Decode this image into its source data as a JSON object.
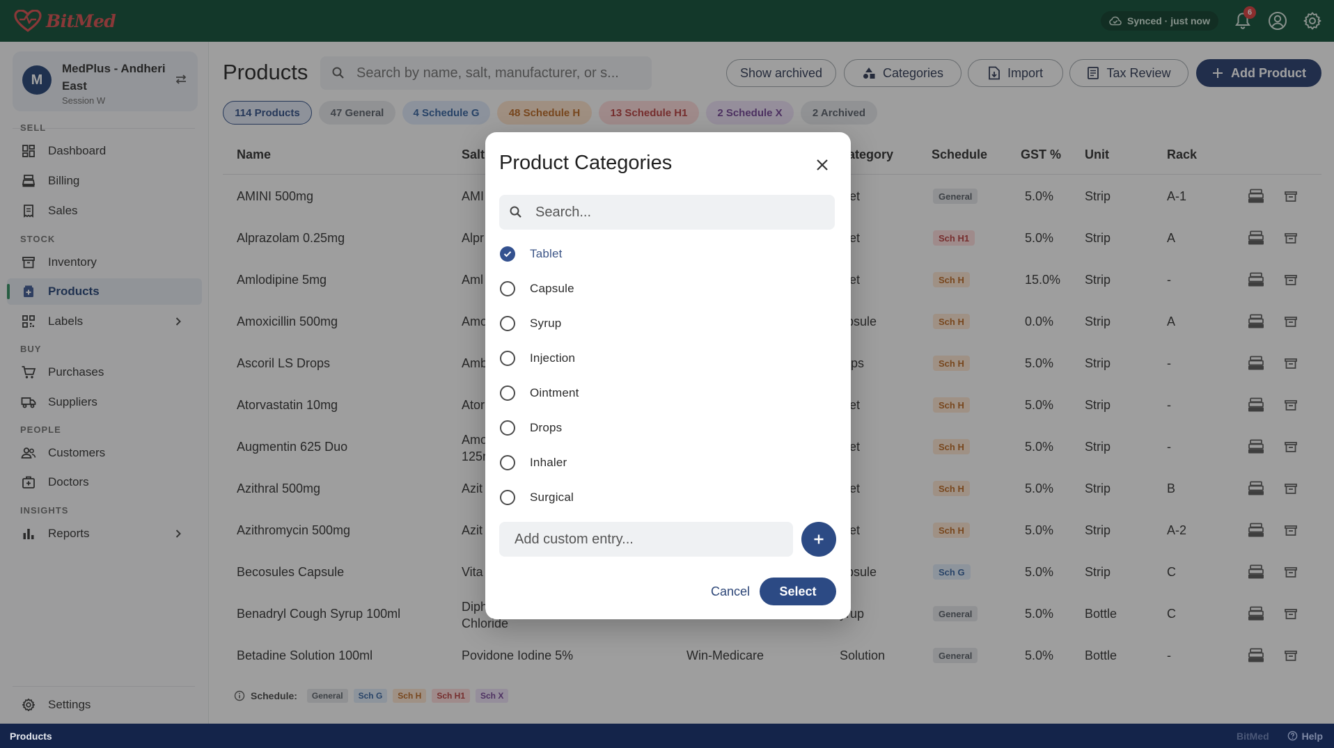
{
  "app": {
    "brand": "BitMed",
    "sync_status": "Synced · just now",
    "notification_count": "6"
  },
  "store": {
    "avatar_letter": "M",
    "name": "MedPlus - Andheri East",
    "session": "Session W"
  },
  "nav": {
    "sections": {
      "sell": "SELL",
      "stock": "STOCK",
      "buy": "BUY",
      "people": "PEOPLE",
      "insights": "INSIGHTS"
    },
    "items": {
      "dashboard": "Dashboard",
      "billing": "Billing",
      "sales": "Sales",
      "inventory": "Inventory",
      "products": "Products",
      "labels": "Labels",
      "purchases": "Purchases",
      "suppliers": "Suppliers",
      "customers": "Customers",
      "doctors": "Doctors",
      "reports": "Reports",
      "settings": "Settings"
    }
  },
  "page": {
    "title": "Products",
    "search_placeholder": "Search by name, salt, manufacturer, or s...",
    "buttons": {
      "show_archived": "Show archived",
      "categories": "Categories",
      "import": "Import",
      "tax_review": "Tax Review",
      "add_product": "Add Product"
    },
    "chips": {
      "all": "114 Products",
      "general": "47 General",
      "schedule_g": "4 Schedule G",
      "schedule_h": "48 Schedule H",
      "schedule_h1": "13 Schedule H1",
      "schedule_x": "2 Schedule X",
      "archived": "2 Archived"
    }
  },
  "table": {
    "headers": {
      "name": "Name",
      "salt": "Salt",
      "category": "ategory",
      "schedule": "Schedule",
      "gst": "GST %",
      "unit": "Unit",
      "rack": "Rack"
    },
    "rows": [
      {
        "name": "AMINI 500mg",
        "salt": "AMI",
        "salt2": "",
        "manufacturer": "",
        "category": "blet",
        "schedule": "General",
        "gst": "5.0%",
        "unit": "Strip",
        "rack": "A-1"
      },
      {
        "name": "Alprazolam 0.25mg",
        "salt": "Alpr",
        "salt2": "",
        "manufacturer": "",
        "category": "blet",
        "schedule": "Sch H1",
        "gst": "5.0%",
        "unit": "Strip",
        "rack": "A"
      },
      {
        "name": "Amlodipine 5mg",
        "salt": "Aml",
        "salt2": "",
        "manufacturer": "",
        "category": "blet",
        "schedule": "Sch H",
        "gst": "15.0%",
        "unit": "Strip",
        "rack": "-"
      },
      {
        "name": "Amoxicillin 500mg",
        "salt": "Amo",
        "salt2": "",
        "manufacturer": "",
        "category": "apsule",
        "schedule": "Sch H",
        "gst": "0.0%",
        "unit": "Strip",
        "rack": "A"
      },
      {
        "name": "Ascoril LS Drops",
        "salt": "Amb",
        "salt2": "",
        "manufacturer": "",
        "category": "rops",
        "schedule": "Sch H",
        "gst": "5.0%",
        "unit": "Strip",
        "rack": "-"
      },
      {
        "name": "Atorvastatin 10mg",
        "salt": "Ator",
        "salt2": "",
        "manufacturer": "",
        "category": "blet",
        "schedule": "Sch H",
        "gst": "5.0%",
        "unit": "Strip",
        "rack": "-"
      },
      {
        "name": "Augmentin 625 Duo",
        "salt": "Amo",
        "salt2": "125r",
        "manufacturer": "",
        "category": "blet",
        "schedule": "Sch H",
        "gst": "5.0%",
        "unit": "Strip",
        "rack": "-"
      },
      {
        "name": "Azithral 500mg",
        "salt": "Azit",
        "salt2": "",
        "manufacturer": "",
        "category": "blet",
        "schedule": "Sch H",
        "gst": "5.0%",
        "unit": "Strip",
        "rack": "B"
      },
      {
        "name": "Azithromycin 500mg",
        "salt": "Azit",
        "salt2": "",
        "manufacturer": "",
        "category": "blet",
        "schedule": "Sch H",
        "gst": "5.0%",
        "unit": "Strip",
        "rack": "A-2"
      },
      {
        "name": "Becosules Capsule",
        "salt": "Vita",
        "salt2": "",
        "manufacturer": "",
        "category": "apsule",
        "schedule": "Sch G",
        "gst": "5.0%",
        "unit": "Strip",
        "rack": "C"
      },
      {
        "name": "Benadryl Cough Syrup 100ml",
        "salt": "Diph",
        "salt2": "Chloride",
        "manufacturer": "",
        "category": "yrup",
        "schedule": "General",
        "gst": "5.0%",
        "unit": "Bottle",
        "rack": "C"
      },
      {
        "name": "Betadine Solution 100ml",
        "salt": "Povidone Iodine 5%",
        "salt2": "",
        "manufacturer": "Win-Medicare",
        "category": "Solution",
        "schedule": "General",
        "gst": "5.0%",
        "unit": "Bottle",
        "rack": "-"
      }
    ]
  },
  "legend": {
    "label": "Schedule:",
    "items": [
      "General",
      "Sch G",
      "Sch H",
      "Sch H1",
      "Sch X"
    ]
  },
  "modal": {
    "title": "Product Categories",
    "search_placeholder": "Search...",
    "options": [
      {
        "label": "Tablet",
        "selected": true
      },
      {
        "label": "Capsule",
        "selected": false
      },
      {
        "label": "Syrup",
        "selected": false
      },
      {
        "label": "Injection",
        "selected": false
      },
      {
        "label": "Ointment",
        "selected": false
      },
      {
        "label": "Drops",
        "selected": false
      },
      {
        "label": "Inhaler",
        "selected": false
      },
      {
        "label": "Surgical",
        "selected": false
      }
    ],
    "custom_placeholder": "Add custom entry...",
    "cancel": "Cancel",
    "select": "Select"
  },
  "statusbar": {
    "page": "Products",
    "brand": "BitMed",
    "help": "Help"
  },
  "colors": {
    "topbar": "#0c4b32",
    "accent": "#243a6b",
    "statusbar": "#14244a"
  }
}
